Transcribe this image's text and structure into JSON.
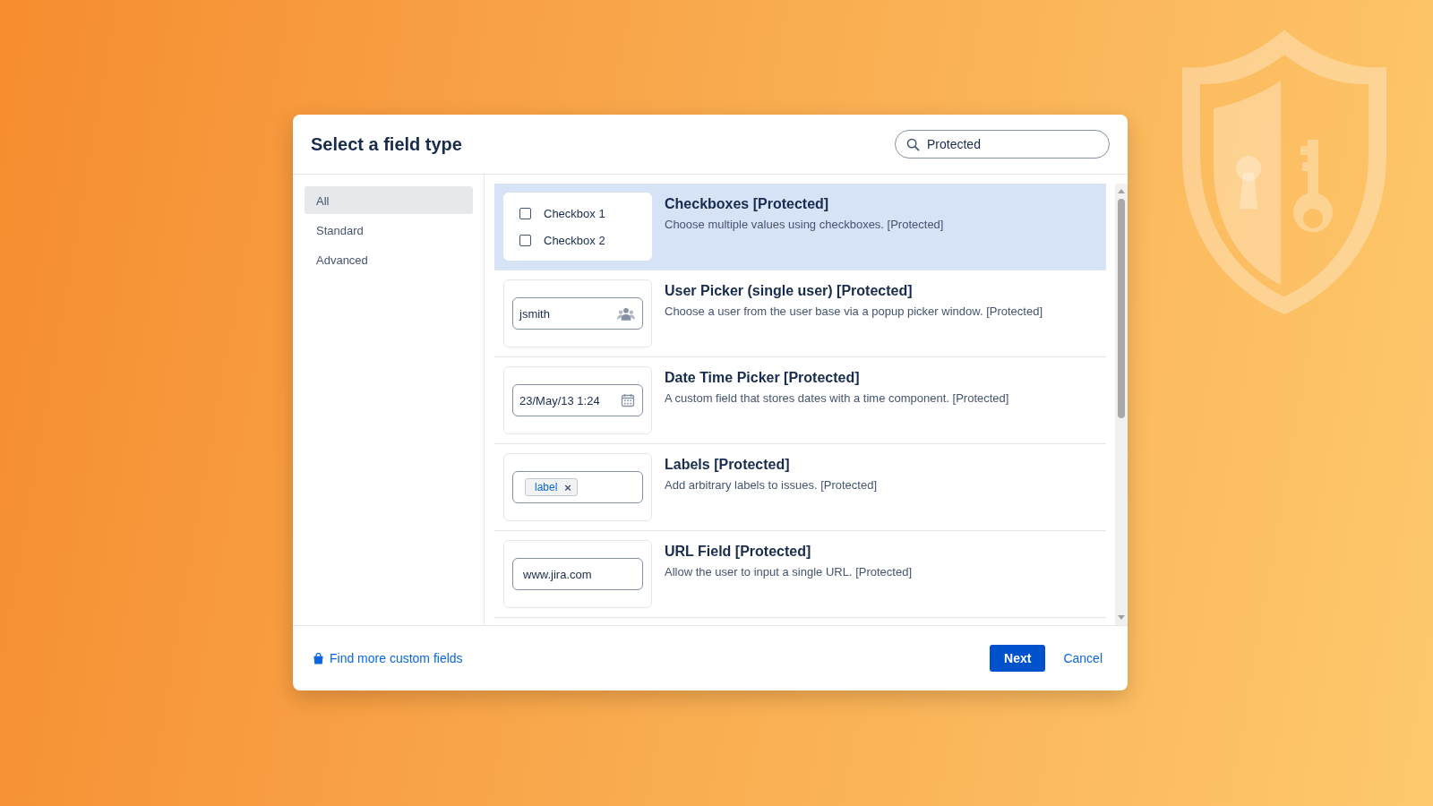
{
  "dialog": {
    "title": "Select a field type",
    "search": {
      "value": "Protected"
    },
    "sidebar": {
      "items": [
        {
          "label": "All",
          "selected": true
        },
        {
          "label": "Standard",
          "selected": false
        },
        {
          "label": "Advanced",
          "selected": false
        }
      ]
    },
    "field_types": [
      {
        "kind": "checkboxes",
        "title": "Checkboxes [Protected]",
        "description": "Choose multiple values using checkboxes. [Protected]",
        "selected": true,
        "preview": {
          "options": [
            {
              "label": "Checkbox 1",
              "checked": false
            },
            {
              "label": "Checkbox 2",
              "checked": false
            }
          ]
        }
      },
      {
        "kind": "user",
        "title": "User Picker (single user) [Protected]",
        "description": "Choose a user from the user base via a popup picker window. [Protected]",
        "selected": false,
        "preview": {
          "value": "jsmith"
        }
      },
      {
        "kind": "date",
        "title": "Date Time Picker [Protected]",
        "description": "A custom field that stores dates with a time component. [Protected]",
        "selected": false,
        "preview": {
          "value": "23/May/13 1:24"
        }
      },
      {
        "kind": "labels",
        "title": "Labels [Protected]",
        "description": "Add arbitrary labels to issues. [Protected]",
        "selected": false,
        "preview": {
          "tag": "label",
          "remove": "×"
        }
      },
      {
        "kind": "url",
        "title": "URL Field [Protected]",
        "description": "Allow the user to input a single URL. [Protected]",
        "selected": false,
        "preview": {
          "value": "www.jira.com"
        }
      }
    ],
    "footer": {
      "link": "Find more custom fields",
      "buttons": [
        {
          "kind": "primary",
          "label": "Next"
        },
        {
          "kind": "link",
          "label": "Cancel"
        }
      ]
    }
  }
}
